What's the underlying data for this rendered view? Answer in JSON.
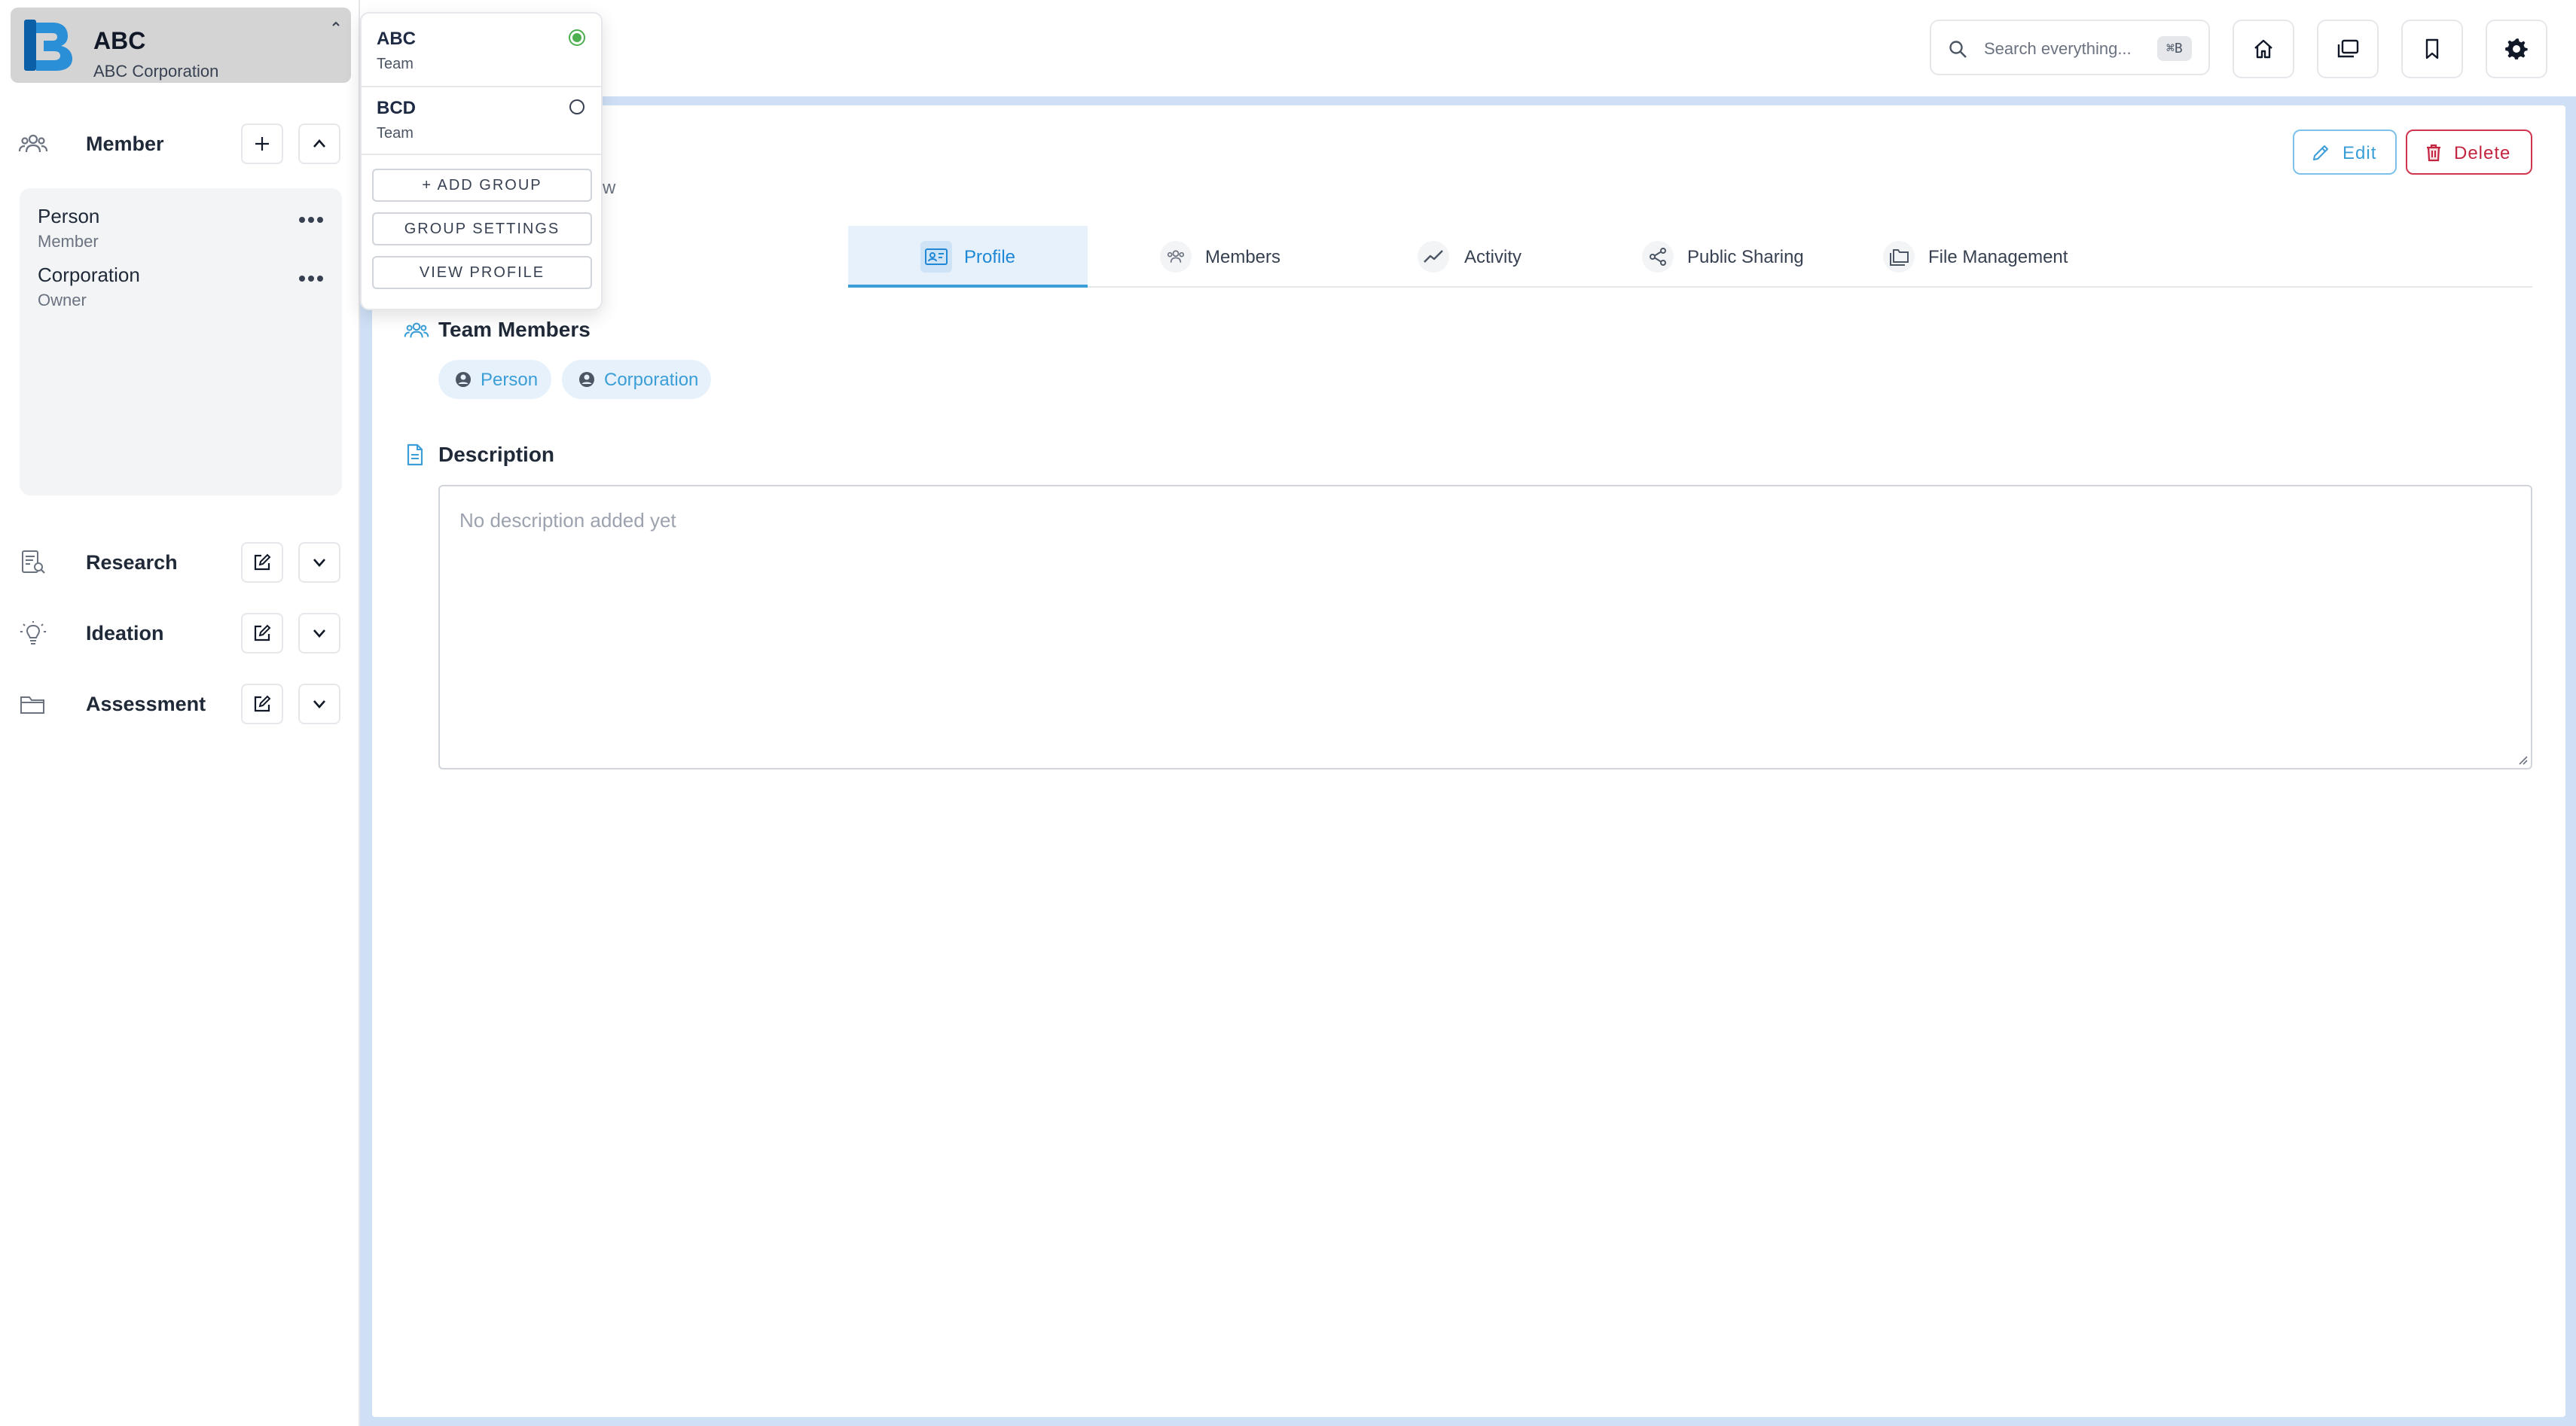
{
  "org": {
    "name": "ABC",
    "subtitle": "ABC Corporation"
  },
  "sidebar": {
    "member_section": {
      "label": "Member"
    },
    "members": [
      {
        "name": "Person",
        "role": "Member"
      },
      {
        "name": "Corporation",
        "role": "Owner"
      }
    ],
    "sections": [
      {
        "label": "Research"
      },
      {
        "label": "Ideation"
      },
      {
        "label": "Assessment"
      }
    ]
  },
  "search": {
    "placeholder": "Search everything...",
    "shortcut": "⌘B"
  },
  "page": {
    "subtitle_fragment": "w"
  },
  "actions": {
    "edit": "Edit",
    "delete": "Delete"
  },
  "tabs": [
    {
      "label": "Profile",
      "active": true
    },
    {
      "label": "Members"
    },
    {
      "label": "Activity"
    },
    {
      "label": "Public Sharing"
    },
    {
      "label": "File Management"
    }
  ],
  "team_members": {
    "title": "Team Members",
    "chips": [
      "Person",
      "Corporation"
    ]
  },
  "description": {
    "title": "Description",
    "placeholder": "No description added yet"
  },
  "dropdown": {
    "groups": [
      {
        "name": "ABC",
        "type": "Team",
        "selected": true
      },
      {
        "name": "BCD",
        "type": "Team",
        "selected": false
      }
    ],
    "buttons": {
      "add_group": "ADD GROUP",
      "group_settings": "GROUP SETTINGS",
      "view_profile": "VIEW PROFILE"
    }
  },
  "colors": {
    "accent": "#3b9ed7",
    "danger": "#c3243f",
    "selected_radio": "#4caf50"
  }
}
